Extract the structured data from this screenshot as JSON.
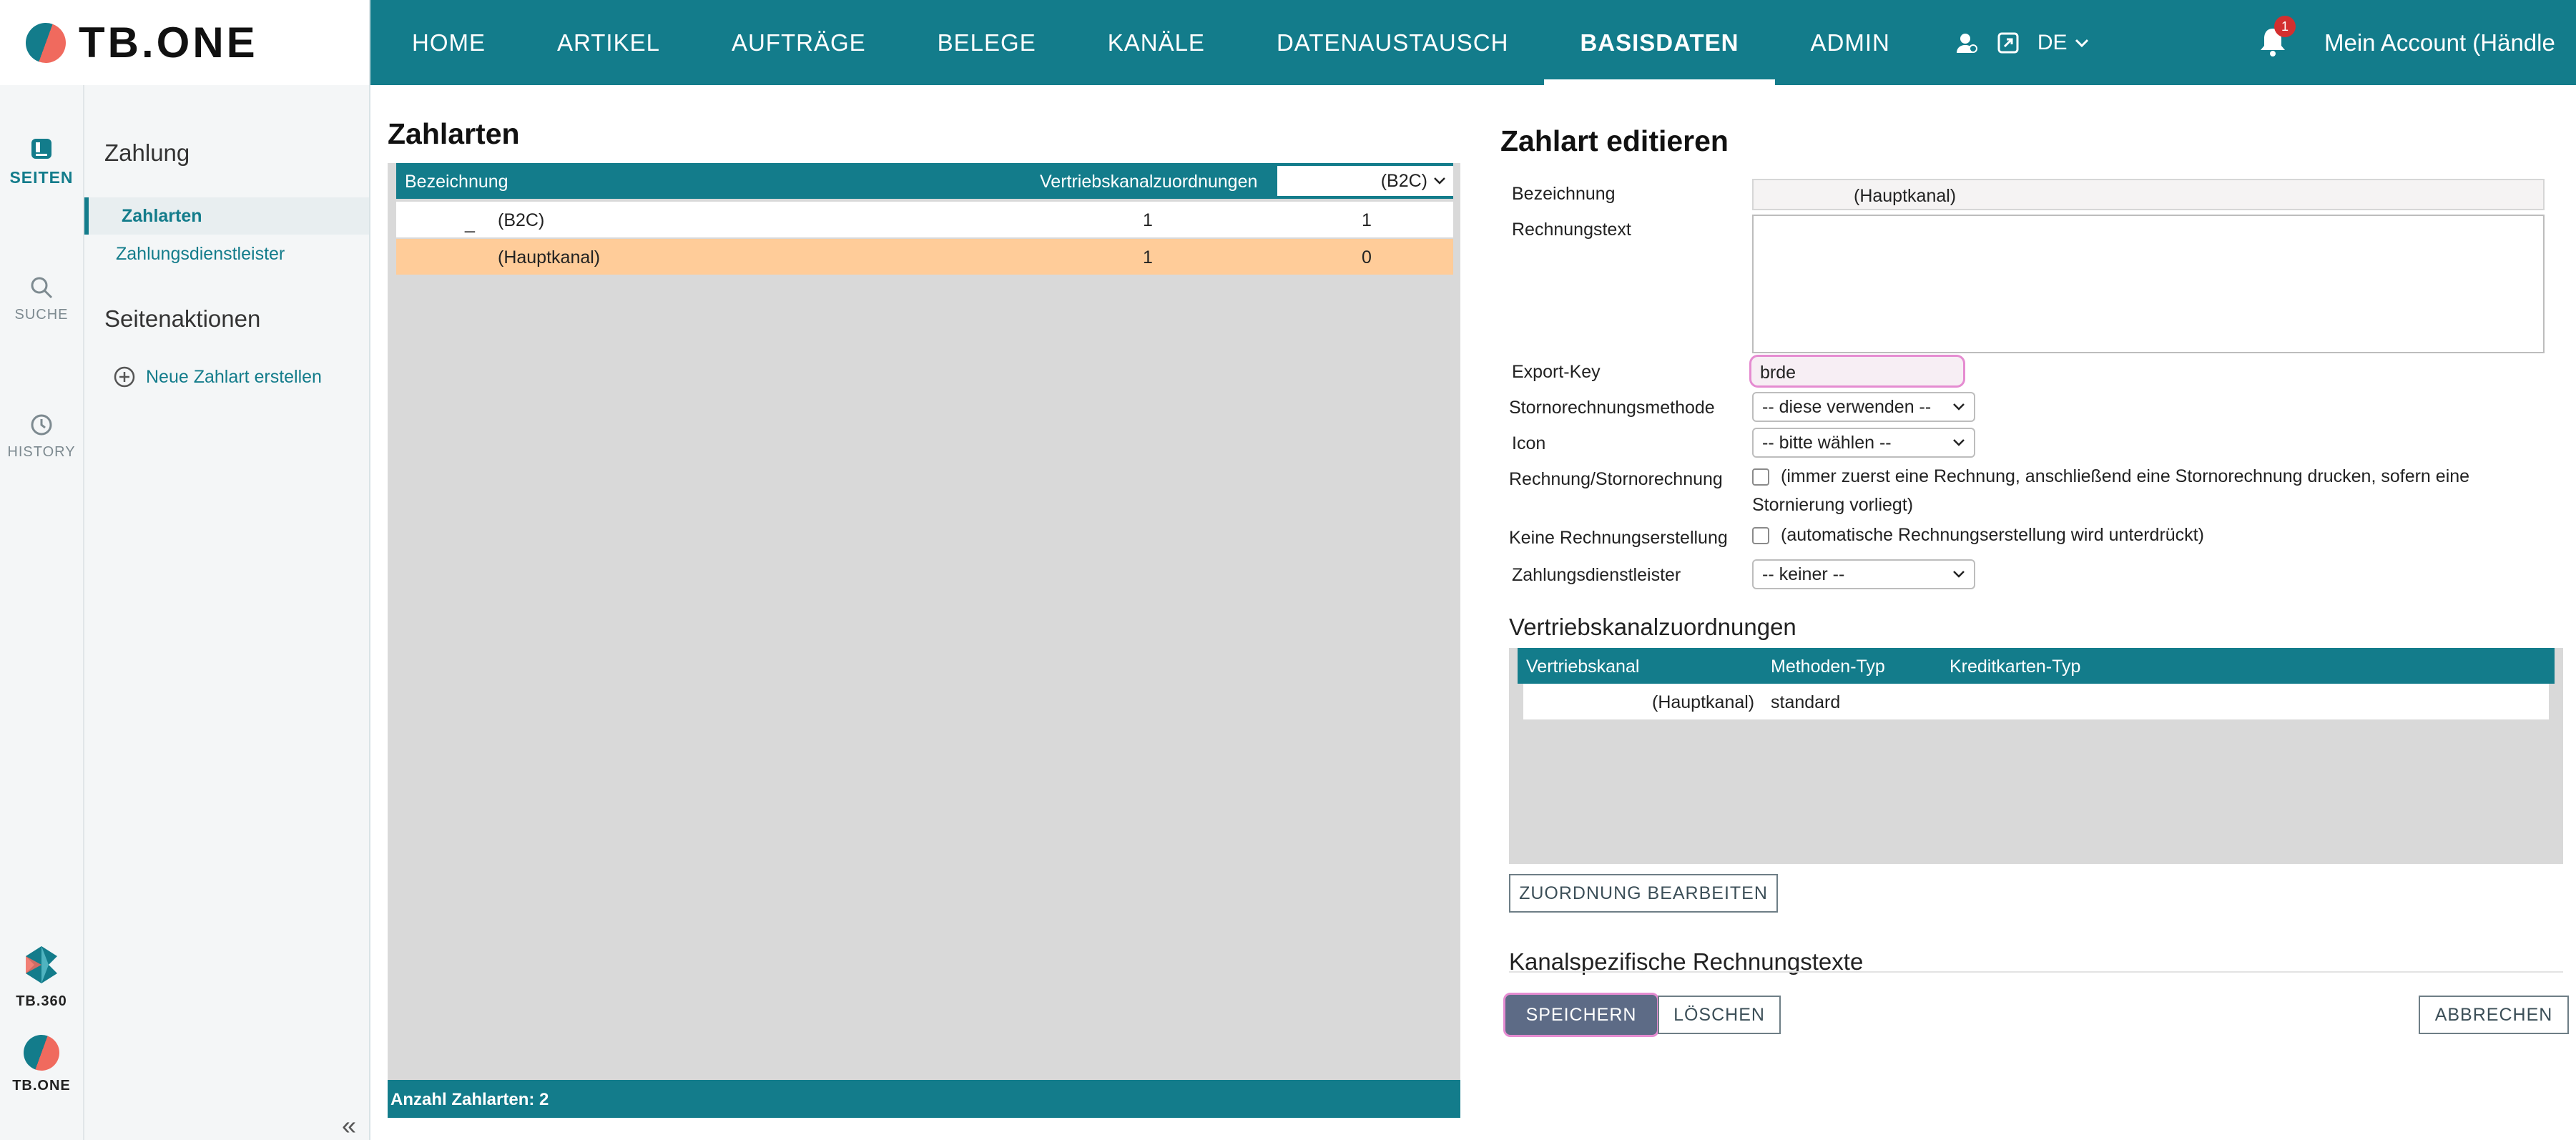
{
  "app": {
    "logo_text": "TB.ONE"
  },
  "nav": {
    "items": [
      {
        "label": "HOME"
      },
      {
        "label": "ARTIKEL"
      },
      {
        "label": "AUFTRÄGE"
      },
      {
        "label": "BELEGE"
      },
      {
        "label": "KANÄLE"
      },
      {
        "label": "DATENAUSTAUSCH"
      },
      {
        "label": "BASISDATEN",
        "active": true
      },
      {
        "label": "ADMIN"
      }
    ],
    "language": "DE",
    "notification_count": "1",
    "account_label": "Mein Account (Händle"
  },
  "rail": {
    "seiten": "SEITEN",
    "suche": "SUCHE",
    "history": "HISTORY",
    "tb360": "TB.360",
    "tbone": "TB.ONE"
  },
  "sidebar": {
    "heading": "Zahlung",
    "links": [
      {
        "label": "Zahlarten",
        "active": true
      },
      {
        "label": "Zahlungsdienstleister"
      }
    ],
    "actions_heading": "Seitenaktionen",
    "action_new": "Neue Zahlart erstellen"
  },
  "list": {
    "title": "Zahlarten",
    "columns": {
      "name": "Bezeichnung",
      "assignments": "Vertriebskanalzuordnungen",
      "channel_filter": "(B2C)"
    },
    "rows": [
      {
        "prefix": "_",
        "name": "(B2C)",
        "assignments": "1",
        "channel": "1",
        "selected": false
      },
      {
        "prefix": "",
        "name": "(Hauptkanal)",
        "assignments": "1",
        "channel": "0",
        "selected": true
      }
    ],
    "footer": "Anzahl Zahlarten: 2"
  },
  "edit": {
    "title": "Zahlart editieren",
    "labels": {
      "name": "Bezeichnung",
      "invoice_text": "Rechnungstext",
      "export_key": "Export-Key",
      "storno_method": "Stornorechnungsmethode",
      "icon": "Icon",
      "invoice_storno": "Rechnung/Stornorechnung",
      "no_invoice": "Keine Rechnungserstellung",
      "payment_provider": "Zahlungsdienstleister"
    },
    "values": {
      "name": "(Hauptkanal)",
      "invoice_text": "",
      "export_key": "brde",
      "storno_method": "-- diese verwenden --",
      "icon": "-- bitte wählen --",
      "invoice_storno_text_1": "(immer zuerst eine Rechnung, anschließend eine Stornorechnung drucken, sofern eine",
      "invoice_storno_text_2": "Stornierung vorliegt)",
      "no_invoice_text": "(automatische Rechnungserstellung wird unterdrückt)",
      "payment_provider": "-- keiner --"
    },
    "assignments": {
      "title": "Vertriebskanalzuordnungen",
      "columns": {
        "channel": "Vertriebskanal",
        "method_type": "Methoden-Typ",
        "card_type": "Kreditkarten-Typ"
      },
      "rows": [
        {
          "channel": "(Hauptkanal)",
          "method_type": "standard",
          "card_type": ""
        }
      ],
      "edit_button": "ZUORDNUNG BEARBEITEN"
    },
    "channel_texts_title": "Kanalspezifische Rechnungstexte",
    "buttons": {
      "save": "SPEICHERN",
      "delete": "LÖSCHEN",
      "cancel": "ABBRECHEN"
    }
  }
}
